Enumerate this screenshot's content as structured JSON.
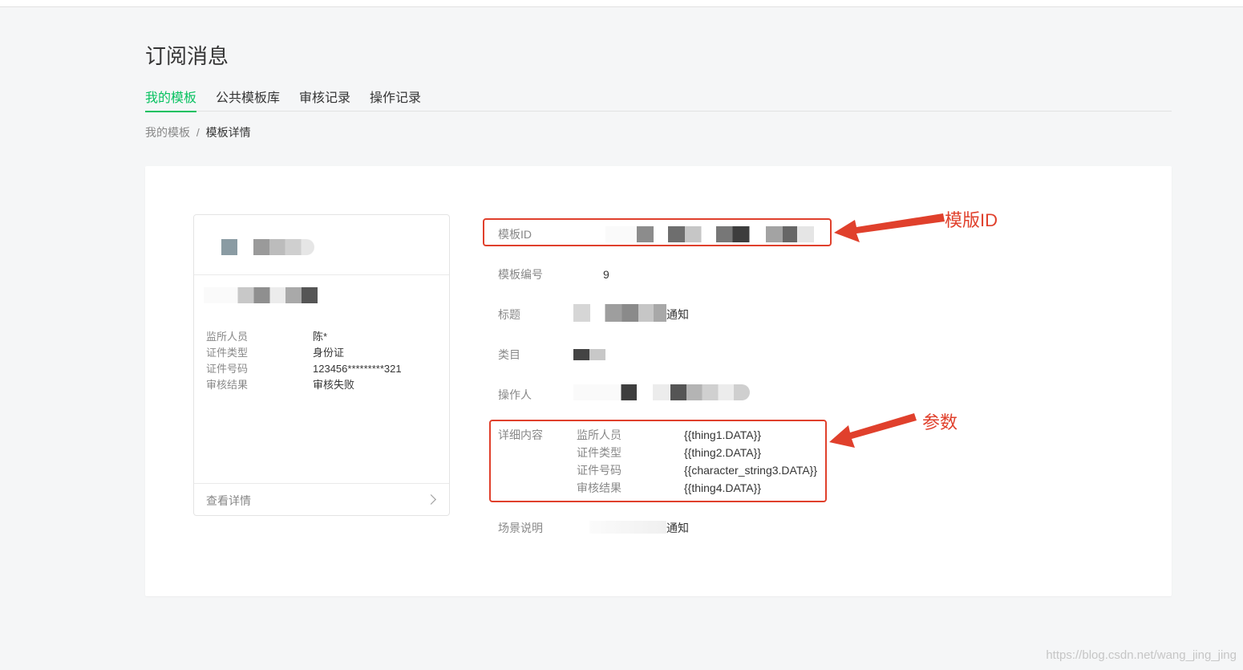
{
  "page": {
    "title": "订阅消息"
  },
  "tabs": [
    {
      "label": "我的模板",
      "active": true
    },
    {
      "label": "公共模板库",
      "active": false
    },
    {
      "label": "审核记录",
      "active": false
    },
    {
      "label": "操作记录",
      "active": false
    }
  ],
  "breadcrumb": {
    "parent": "我的模板",
    "separator": "/",
    "current": "模板详情"
  },
  "preview_card": {
    "fields": [
      {
        "key": "监所人员",
        "value": "陈*"
      },
      {
        "key": "证件类型",
        "value": "身份证"
      },
      {
        "key": "证件号码",
        "value": "123456*********321"
      },
      {
        "key": "审核结果",
        "value": "审核失败"
      }
    ],
    "footer_label": "查看详情"
  },
  "details": {
    "template_id_label": "模板ID",
    "template_no_label": "模板编号",
    "template_no_value": "9",
    "title_label": "标题",
    "title_value_suffix": "通知",
    "category_label": "类目",
    "operator_label": "操作人",
    "content_label": "详细内容",
    "content_rows": [
      {
        "key": "监所人员",
        "value": "{{thing1.DATA}}"
      },
      {
        "key": "证件类型",
        "value": "{{thing2.DATA}}"
      },
      {
        "key": "证件号码",
        "value": "{{character_string3.DATA}}"
      },
      {
        "key": "审核结果",
        "value": "{{thing4.DATA}}"
      }
    ],
    "scene_label": "场景说明",
    "scene_value_suffix": "通知"
  },
  "annotations": {
    "template_id": "模版ID",
    "params": "参数",
    "color": "#e0402c"
  },
  "watermark": "https://blog.csdn.net/wang_jing_jing",
  "colors": {
    "accent": "#07c160",
    "background": "#f5f6f7",
    "annotation": "#e0402c"
  }
}
